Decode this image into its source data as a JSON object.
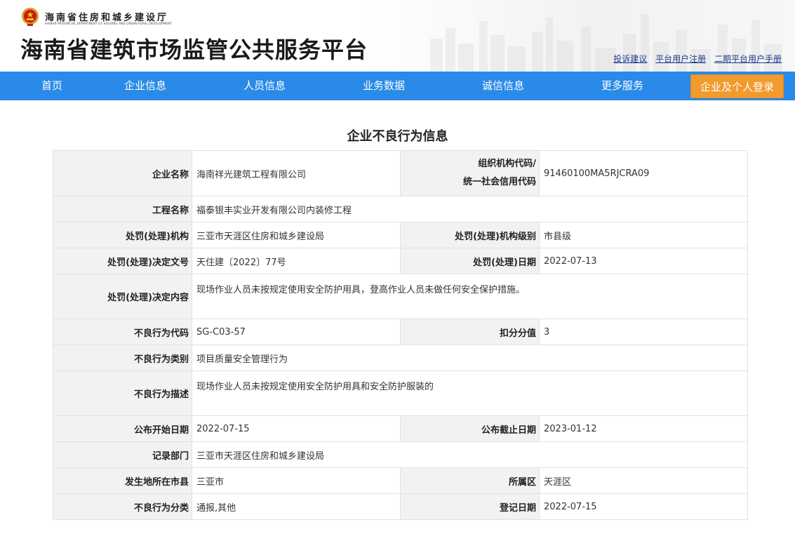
{
  "header": {
    "dept_cn": "海南省住房和城乡建设厅",
    "dept_en": "HAINAN PROVINCIAL DEPARTMENT OF HOUSING AND URBAN-RURAL DEVELOPMENT",
    "site_title": "海南省建筑市场监管公共服务平台",
    "links": [
      "投诉建议",
      "平台用户注册",
      "二期平台用户手册"
    ]
  },
  "nav": {
    "items": [
      "首页",
      "企业信息",
      "人员信息",
      "业务数据",
      "诚信信息",
      "更多服务"
    ],
    "login": "企业及个人登录",
    "bg_color": "#2a8ae8",
    "login_color": "#f29a2e"
  },
  "page_title": "企业不良行为信息",
  "rows": {
    "company_name": {
      "label": "企业名称",
      "value": "海南祥光建筑工程有限公司"
    },
    "org_code": {
      "label_line1": "组织机构代码/",
      "label_line2": "统一社会信用代码",
      "value": "91460100MA5RJCRA09"
    },
    "project_name": {
      "label": "工程名称",
      "value": "福泰银丰实业开发有限公司内装修工程"
    },
    "penalty_org": {
      "label": "处罚(处理)机构",
      "value": "三亚市天涯区住房和城乡建设局"
    },
    "penalty_org_level": {
      "label": "处罚(处理)机构级别",
      "value": "市县级"
    },
    "decision_no": {
      "label": "处罚(处理)决定文号",
      "value": "天住建〔2022〕77号"
    },
    "penalty_date": {
      "label": "处罚(处理)日期",
      "value": "2022-07-13"
    },
    "decision_content": {
      "label": "处罚(处理)决定内容",
      "value": "现场作业人员未按规定使用安全防护用具，登高作业人员未做任何安全保护措施。"
    },
    "bad_code": {
      "label": "不良行为代码",
      "value": "SG-C03-57"
    },
    "deduct": {
      "label": "扣分分值",
      "value": "3"
    },
    "bad_category": {
      "label": "不良行为类别",
      "value": "项目质量安全管理行为"
    },
    "bad_desc": {
      "label": "不良行为描述",
      "value": "现场作业人员未按规定使用安全防护用具和安全防护服装的"
    },
    "publish_start": {
      "label": "公布开始日期",
      "value": "2022-07-15"
    },
    "publish_end": {
      "label": "公布截止日期",
      "value": "2023-01-12"
    },
    "record_dept": {
      "label": "记录部门",
      "value": "三亚市天涯区住房和城乡建设局"
    },
    "city": {
      "label": "发生地所在市县",
      "value": "三亚市"
    },
    "district": {
      "label": "所属区",
      "value": "天涯区"
    },
    "classification": {
      "label": "不良行为分类",
      "value": "通报,其他"
    },
    "register_date": {
      "label": "登记日期",
      "value": "2022-07-15"
    }
  }
}
